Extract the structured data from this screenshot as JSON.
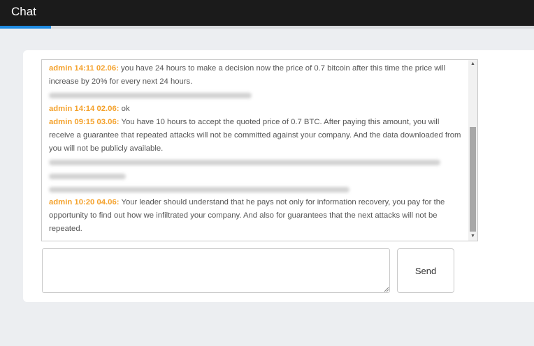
{
  "header": {
    "title": "Chat"
  },
  "messages": [
    {
      "author": "admin",
      "time": "14:11",
      "date": "02.06:",
      "text": "you have 24 hours to make a decision now the price of 0.7 bitcoin after this time the price will increase by 20% for every next 24 hours."
    },
    {
      "author": "admin",
      "time": "14:14",
      "date": "02.06:",
      "text": "ok"
    },
    {
      "author": "admin",
      "time": "09:15",
      "date": "03.06:",
      "text": "You have 10 hours to accept the quoted price of 0.7 BTC. After paying this amount, you will receive a guarantee that repeated attacks will not be committed against your company. And the data downloaded from you will not be publicly available."
    },
    {
      "author": "admin",
      "time": "10:20",
      "date": "04.06:",
      "text": "Your leader should understand that he pays not only for information recovery, you pay for the opportunity to find out how we infiltrated your company. And also for guarantees that the next attacks will not be repeated."
    }
  ],
  "composer": {
    "value": "",
    "send_label": "Send"
  },
  "colors": {
    "author": "#f4a12b",
    "accent": "#1e8ae0",
    "topbar": "#1b1b1b"
  }
}
